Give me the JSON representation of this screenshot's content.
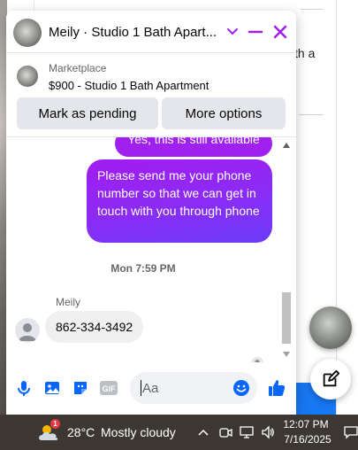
{
  "background": {
    "partial_text": "th a"
  },
  "chat": {
    "title": "Meily · Studio 1 Bath Apart...",
    "marketplace": {
      "label": "Marketplace",
      "listing": "$900 - Studio 1 Bath Apartment"
    },
    "actions": {
      "mark_pending": "Mark as pending",
      "more_options": "More options"
    },
    "messages": {
      "outgoing_partial": "Yes, this is still available",
      "outgoing": "Please send me your phone number so that we can get in touch with you through phone",
      "timestamp": "Mon 7:59 PM",
      "sender": "Meily",
      "incoming": "862-334-3492"
    },
    "composer": {
      "placeholder": "Aa",
      "icons": [
        "microphone-icon",
        "photo-icon",
        "sticker-icon",
        "gif-icon",
        "emoji-icon",
        "thumbs-up-icon"
      ],
      "gif_label": "GIF"
    },
    "colors": {
      "accent": "#a020f0",
      "gradient_end": "#6b3cf8",
      "like": "#0866ff"
    }
  },
  "taskbar": {
    "temperature": "28°C",
    "condition": "Mostly cloudy",
    "weather_badge": "1",
    "time": "12:07 PM",
    "date": "7/16/2025"
  }
}
